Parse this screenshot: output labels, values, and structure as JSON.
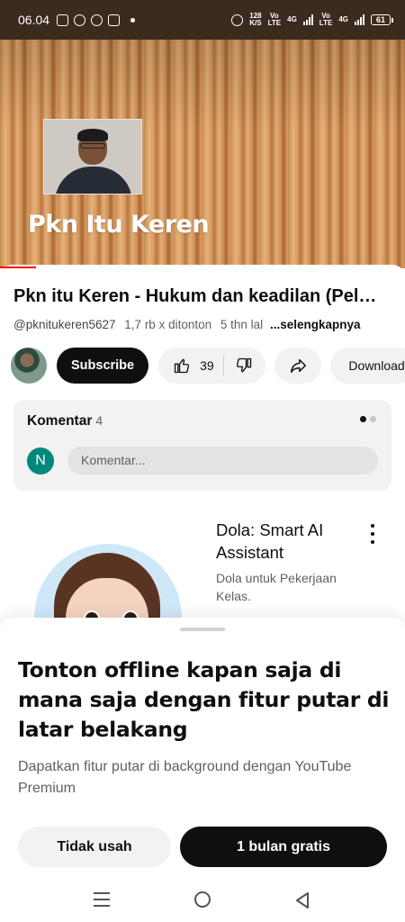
{
  "status_bar": {
    "time": "06.04",
    "net_speed": "128",
    "net_speed_unit": "K/S",
    "sim1_label": "Vo",
    "sim1_sub": "LTE",
    "sim1_net": "4G",
    "sim2_label": "Vo",
    "sim2_sub": "LTE",
    "sim2_net": "4G",
    "battery": "61"
  },
  "video": {
    "caption": "Pkn Itu Keren",
    "title": "Pkn itu Keren - Hukum dan keadilan (Pel…",
    "channel_handle": "@pknitukeren5627",
    "views": "1,7 rb x ditonton",
    "age": "5 thn lal",
    "more_label": "...selengkapnya"
  },
  "actions": {
    "subscribe_label": "Subscribe",
    "like_count": "39",
    "download_label": "Download"
  },
  "comments": {
    "label": "Komentar",
    "count": "4",
    "user_initial": "N",
    "placeholder": "Komentar..."
  },
  "ad": {
    "title": "Dola: Smart AI Assistant",
    "description": "Dola untuk Pekerjaan Kelas."
  },
  "sheet": {
    "title": "Tonton offline kapan saja di mana saja dengan fitur putar di latar belakang",
    "description": "Dapatkan fitur putar di background dengan YouTube Premium",
    "secondary_button": "Tidak usah",
    "primary_button": "1 bulan gratis"
  },
  "colors": {
    "accent": "#ff0000",
    "primary_button_bg": "#0f0f0f",
    "avatar_bg": "#00897b"
  },
  "icons": [
    "instagram-icon",
    "whatsapp-icon",
    "alarm-icon",
    "powerpoint-icon",
    "like-icon",
    "dislike-icon",
    "share-icon",
    "download-icon",
    "more-vert-icon",
    "menu-icon",
    "home-icon",
    "back-icon"
  ]
}
